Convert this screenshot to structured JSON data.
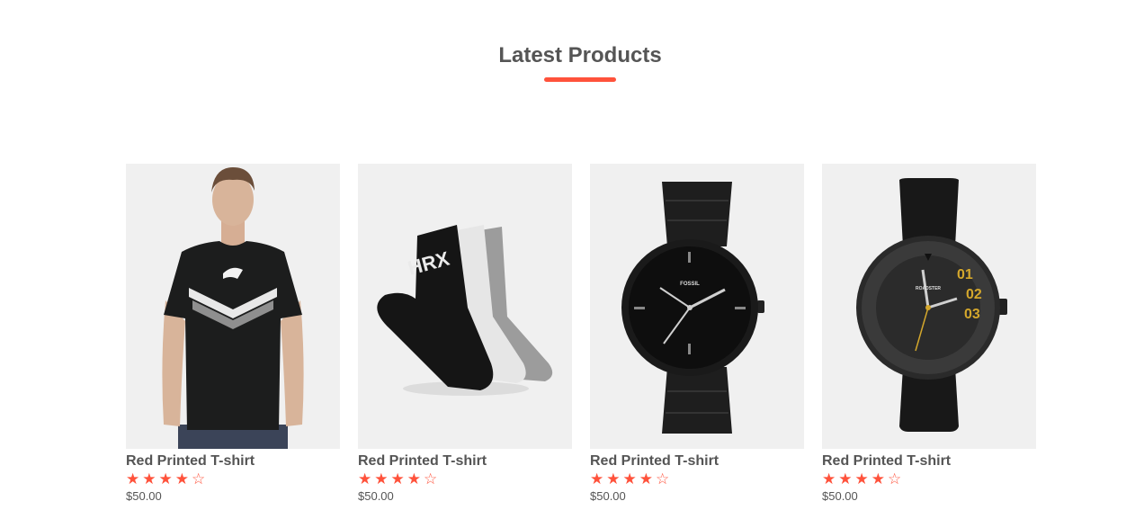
{
  "section": {
    "title": "Latest Products",
    "accent_color": "#ff523b"
  },
  "products": [
    {
      "name": "Red Printed T-shirt",
      "price": "$50.00",
      "rating": 4,
      "rating_max": 5,
      "image_icon": "black-tshirt-model-image",
      "brand_print": ""
    },
    {
      "name": "Red Printed T-shirt",
      "price": "$50.00",
      "rating": 4,
      "rating_max": 5,
      "image_icon": "socks-image",
      "brand_print": "HRX"
    },
    {
      "name": "Red Printed T-shirt",
      "price": "$50.00",
      "rating": 4,
      "rating_max": 5,
      "image_icon": "black-metal-watch-image",
      "brand_print": "FOSSIL"
    },
    {
      "name": "Red Printed T-shirt",
      "price": "$50.00",
      "rating": 4,
      "rating_max": 5,
      "image_icon": "black-leather-watch-image",
      "brand_print": "ROADSTER"
    }
  ]
}
